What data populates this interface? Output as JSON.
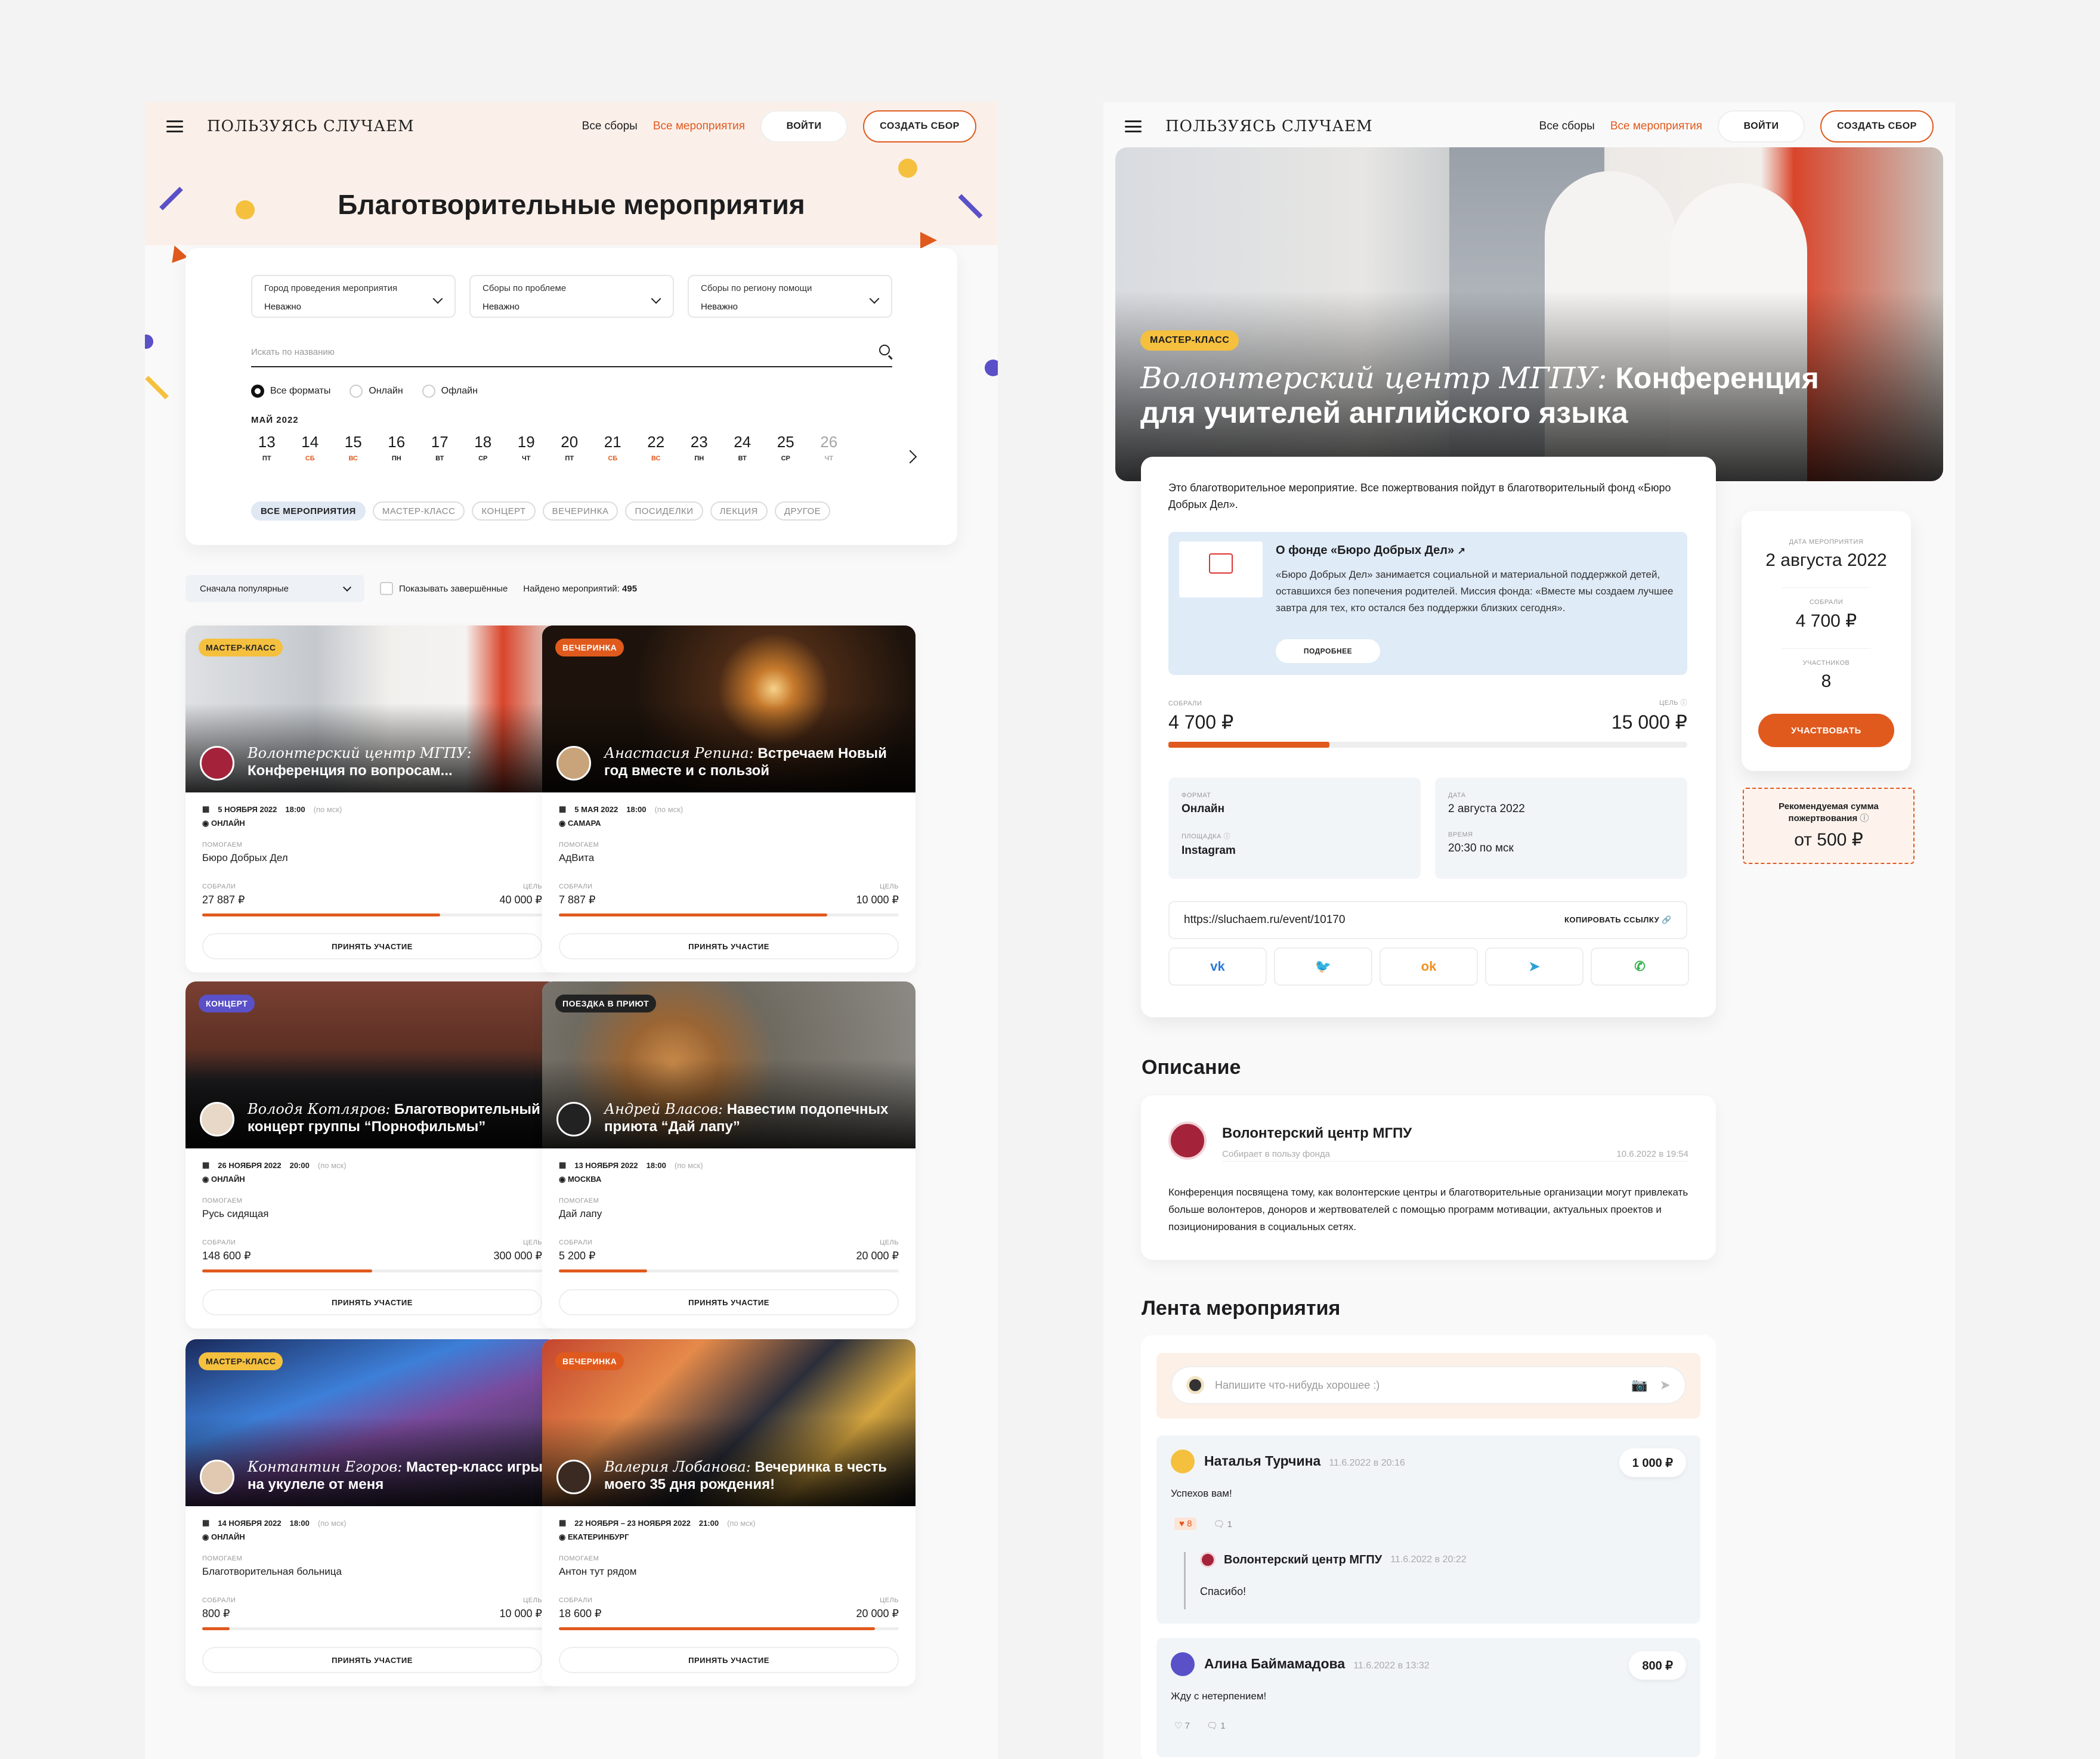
{
  "brand": {
    "logo": "ПОЛЬЗУЯСЬ СЛУЧАЕМ",
    "accent": "#e05a1e"
  },
  "header": {
    "nav_all": "Все сборы",
    "nav_events": "Все мероприятия",
    "login": "ВОЙТИ",
    "create": "СОЗДАТЬ СБОР"
  },
  "list": {
    "title": "Благотворительные мероприятия",
    "filters": [
      {
        "label": "Город проведения мероприятия",
        "value": "Неважно"
      },
      {
        "label": "Сборы по проблеме",
        "value": "Неважно"
      },
      {
        "label": "Сборы по региону помощи",
        "value": "Неважно"
      }
    ],
    "search_placeholder": "Искать по названию",
    "formats": [
      "Все форматы",
      "Онлайн",
      "Офлайн"
    ],
    "month": "МАЙ 2022",
    "days": [
      {
        "n": "13",
        "w": "ПТ",
        "red": false
      },
      {
        "n": "14",
        "w": "СБ",
        "red": true
      },
      {
        "n": "15",
        "w": "ВС",
        "red": true
      },
      {
        "n": "16",
        "w": "ПН",
        "red": false
      },
      {
        "n": "17",
        "w": "ВТ",
        "red": false
      },
      {
        "n": "18",
        "w": "СР",
        "red": false
      },
      {
        "n": "19",
        "w": "ЧТ",
        "red": false
      },
      {
        "n": "20",
        "w": "ПТ",
        "red": false
      },
      {
        "n": "21",
        "w": "СБ",
        "red": true
      },
      {
        "n": "22",
        "w": "ВС",
        "red": true
      },
      {
        "n": "23",
        "w": "ПН",
        "red": false
      },
      {
        "n": "24",
        "w": "ВТ",
        "red": false
      },
      {
        "n": "25",
        "w": "СР",
        "red": false
      },
      {
        "n": "26",
        "w": "ЧТ",
        "red": false
      }
    ],
    "tags": [
      "ВСЕ МЕРОПРИЯТИЯ",
      "МАСТЕР-КЛАСС",
      "КОНЦЕРТ",
      "ВЕЧЕРИНКА",
      "ПОСИДЕЛКИ",
      "ЛЕКЦИЯ",
      "ДРУГОЕ"
    ],
    "sort": "Сначала популярные",
    "show_finished": "Показывать завершённые",
    "found_label": "Найдено мероприятий:",
    "found_count": "495",
    "labels": {
      "helping": "ПОМОГАЕМ",
      "raised": "СОБРАЛИ",
      "goal": "ЦЕЛЬ",
      "join": "ПРИНЯТЬ УЧАСТИЕ",
      "tz": "(по мск)"
    },
    "cards": [
      {
        "badge": "МАСТЕР-КЛАСС",
        "author": "Волонтерский центр МГПУ:",
        "title": "Конференция по вопросам...",
        "date": "5 НОЯБРЯ 2022",
        "time": "18:00",
        "place": "ОНЛАЙН",
        "fund": "Бюро Добрых Дел",
        "raised": "27 887 ₽",
        "goal": "40 000 ₽",
        "progress": 0.7
      },
      {
        "badge": "ВЕЧЕРИНКА",
        "author": "Анастасия Репина:",
        "title": "Встречаем Новый год вместе и с пользой",
        "date": "5 МАЯ 2022",
        "time": "18:00",
        "place": "САМАРА",
        "fund": "АдВита",
        "raised": "7 887 ₽",
        "goal": "10 000 ₽",
        "progress": 0.79
      },
      {
        "badge": "КОНЦЕРТ",
        "author": "Володя Котляров:",
        "title": "Благотворительный концерт группы “Порнофильмы”",
        "date": "26 НОЯБРЯ 2022",
        "time": "20:00",
        "place": "ОНЛАЙН",
        "fund": "Русь сидящая",
        "raised": "148 600 ₽",
        "goal": "300 000 ₽",
        "progress": 0.5
      },
      {
        "badge": "ПОЕЗДКА В ПРИЮТ",
        "author": "Андрей Власов:",
        "title": "Навестим подопечных приюта “Дай лапу”",
        "date": "13 НОЯБРЯ 2022",
        "time": "18:00",
        "place": "МОСКВА",
        "fund": "Дай лапу",
        "raised": "5 200 ₽",
        "goal": "20 000 ₽",
        "progress": 0.26
      },
      {
        "badge": "МАСТЕР-КЛАСС",
        "author": "Контантин Егоров:",
        "title": "Мастер-класс игры на укулеле от меня",
        "date": "14 НОЯБРЯ 2022",
        "time": "18:00",
        "place": "ОНЛАЙН",
        "fund": "Благотворительная больница",
        "raised": "800 ₽",
        "goal": "10 000 ₽",
        "progress": 0.08
      },
      {
        "badge": "ВЕЧЕРИНКА",
        "author": "Валерия Лобанова:",
        "title": "Вечеринка в честь моего 35 дня рождения!",
        "date": "22 НОЯБРЯ – 23 НОЯБРЯ 2022",
        "time": "21:00",
        "place": "ЕКАТЕРИНБУРГ",
        "fund": "Антон тут рядом",
        "raised": "18 600 ₽",
        "goal": "20 000 ₽",
        "progress": 0.93
      }
    ]
  },
  "event": {
    "badge": "МАСТЕР-КЛАСС",
    "author": "Волонтерский центр МГПУ:",
    "title": "Конференция для учителей английского языка",
    "intro": "Это благотворительное мероприятие. Все пожертвования пойдут в благотворительный фонд «Бюро Добрых Дел».",
    "fund_name": "О фонде «Бюро Добрых Дел»",
    "fund_text": "«Бюро Добрых Дел» занимается социальной и материальной поддержкой детей, оставшихся без попечения родителей. Миссия фонда: «Вместе мы создаем лучшее завтра для тех, кто остался без поддержки близких сегодня».",
    "fund_more": "ПОДРОБНЕЕ",
    "raised_label": "СОБРАЛИ",
    "goal_label": "ЦЕЛЬ",
    "raised": "4 700 ₽",
    "goal": "15 000 ₽",
    "progress": 0.31,
    "format_label": "ФОРМАТ",
    "format": "Онлайн",
    "platform_label": "ПЛОЩАДКА",
    "platform": "Instagram",
    "date_label": "ДАТА",
    "date": "2 августа 2022",
    "time_label": "ВРЕМЯ",
    "time": "20:30 по мск",
    "url": "https://sluchaem.ru/event/10170",
    "copy": "КОПИРОВАТЬ ССЫЛКУ",
    "shares": [
      "vk",
      "twitter",
      "ok",
      "telegram",
      "whatsapp"
    ],
    "side": {
      "date_label": "ДАТА МЕРОПРИЯТИЯ",
      "date": "2 августа 2022",
      "raised_label": "СОБРАЛИ",
      "raised": "4 700 ₽",
      "members_label": "УЧАСТНИКОВ",
      "members": "8",
      "btn": "УЧАСТВОВАТЬ"
    },
    "recommended_label": "Рекомендуемая сумма пожертвования",
    "recommended": "от 500 ₽",
    "desc_title": "Описание",
    "desc_author": "Волонтерский центр МГПУ",
    "desc_sub": "Собирает в пользу фонда",
    "desc_date": "10.6.2022 в 19:54",
    "desc_text": "Конференция посвящена тому, как волонтерские центры и благотворительные организации могут привлекать больше волонтеров, доноров и жертвователей с помощью программ мотивации, актуальных проектов и позиционирования в социальных сетях.",
    "feed_title": "Лента мероприятия",
    "feed_placeholder": "Напишите что-нибудь хорошее :)",
    "comments": [
      {
        "name": "Наталья Турчина",
        "date": "11.6.2022 в 20:16",
        "sum": "1 000 ₽",
        "text": "Успехов вам!",
        "likes": "8",
        "replies": "1",
        "reply": {
          "name": "Волонтерский центр МГПУ",
          "date": "11.6.2022 в 20:22",
          "text": "Спасибо!"
        }
      },
      {
        "name": "Алина Баймамадова",
        "date": "11.6.2022 в 13:32",
        "sum": "800 ₽",
        "text": "Жду с нетерпением!",
        "likes": "7",
        "replies": "1"
      }
    ]
  }
}
